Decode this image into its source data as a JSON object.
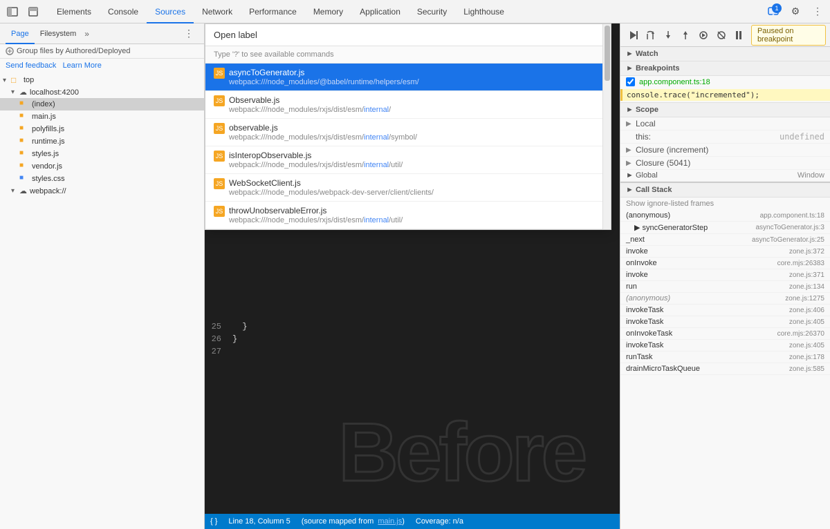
{
  "devtools": {
    "tabs": [
      {
        "label": "Elements",
        "active": false
      },
      {
        "label": "Console",
        "active": false
      },
      {
        "label": "Sources",
        "active": true
      },
      {
        "label": "Network",
        "active": false
      },
      {
        "label": "Performance",
        "active": false
      },
      {
        "label": "Memory",
        "active": false
      },
      {
        "label": "Application",
        "active": false
      },
      {
        "label": "Security",
        "active": false
      },
      {
        "label": "Lighthouse",
        "active": false
      }
    ],
    "badge_count": "1"
  },
  "left_panel": {
    "tabs": [
      "Page",
      "Filesystem"
    ],
    "active_tab": "Page",
    "group_label": "Group files by Authored/Deployed",
    "send_feedback": "Send feedback",
    "learn_more": "Learn More",
    "file_tree": {
      "root": "top",
      "items": [
        {
          "indent": 0,
          "type": "folder-expand",
          "name": "top",
          "selected": false
        },
        {
          "indent": 1,
          "type": "cloud-expand",
          "name": "localhost:4200",
          "selected": false
        },
        {
          "indent": 2,
          "type": "file-special",
          "name": "(index)",
          "selected": true
        },
        {
          "indent": 2,
          "type": "file-js",
          "name": "main.js",
          "selected": false
        },
        {
          "indent": 2,
          "type": "file-js",
          "name": "polyfills.js",
          "selected": false
        },
        {
          "indent": 2,
          "type": "file-js",
          "name": "runtime.js",
          "selected": false
        },
        {
          "indent": 2,
          "type": "file-js",
          "name": "styles.js",
          "selected": false
        },
        {
          "indent": 2,
          "type": "file-js",
          "name": "vendor.js",
          "selected": false
        },
        {
          "indent": 2,
          "type": "file-css",
          "name": "styles.css",
          "selected": false
        },
        {
          "indent": 1,
          "type": "cloud-expand",
          "name": "webpack://",
          "selected": false
        }
      ]
    }
  },
  "open_file_dialog": {
    "label": "Open",
    "input_value": "label",
    "hint": "Type '?' to see available commands",
    "results": [
      {
        "name": "asyncToGenerator.js",
        "path": "webpack:///node_modules/@babel/runtime/helpers/esm/",
        "path_highlight_start": 45,
        "active": true
      },
      {
        "name": "Observable.js",
        "path": "webpack:///node_modules/rxjs/dist/esm/internal/",
        "path_highlight": "internal",
        "active": false
      },
      {
        "name": "observable.js",
        "path": "webpack:///node_modules/rxjs/dist/esm/internal/symbol/",
        "path_highlight": "internal",
        "active": false
      },
      {
        "name": "isInteropObservable.js",
        "path": "webpack:///node_modules/rxjs/dist/esm/internal/util/",
        "path_highlight": "internal",
        "active": false
      },
      {
        "name": "WebSocketClient.js",
        "path": "webpack:///node_modules/webpack-dev-server/client/clients/",
        "path_highlight": null,
        "active": false
      },
      {
        "name": "throwUnobservableError.js",
        "path": "webpack:///node_modules/rxjs/dist/esm/internal/util/",
        "path_highlight": "internal",
        "active": false
      }
    ]
  },
  "editor": {
    "lines": [
      {
        "num": 25,
        "code": "  }"
      },
      {
        "num": 26,
        "code": "}"
      },
      {
        "num": 27,
        "code": ""
      }
    ],
    "watermark": "Before",
    "bottom_bar": {
      "location": "Line 18, Column 5",
      "source_map": "(source mapped from",
      "source_file": "main.js",
      "coverage": "Coverage: n/a"
    }
  },
  "right_panel": {
    "toolbar_icons": [
      "resume",
      "step-over",
      "step-into",
      "step-out",
      "step",
      "deactivate",
      "pause"
    ],
    "paused_label": "Paused on breakpoint",
    "sections": {
      "watch": "atch",
      "breakpoints": {
        "title": "eakpoints",
        "file": "app.component.ts:18",
        "code": "console.trace(\"incremented\");"
      },
      "scope": {
        "title": "cope",
        "items": [
          {
            "arrow": false,
            "name": "ocal",
            "val": ""
          },
          {
            "arrow": false,
            "name": "his:",
            "val": "undefined"
          },
          {
            "arrow": true,
            "name": "osure (increment)",
            "val": ""
          },
          {
            "arrow": true,
            "name": "osure (5041)",
            "val": ""
          },
          {
            "name": "lobal",
            "val": "Window",
            "arrow": false
          }
        ]
      },
      "call_stack": {
        "title": "all Stack",
        "show_ignore": "how ignore-listed frames",
        "items": [
          {
            "fn": "(anonymous)",
            "file": "app.component.ts:18",
            "italic": false
          },
          {
            "fn": "▶ syncGeneratorStep",
            "file": "",
            "italic": false,
            "indent": true
          },
          {
            "fn": "_next",
            "file": "asyncToGenerator.js:25",
            "italic": false
          },
          {
            "fn": "invoke",
            "file": "zone.js:372",
            "italic": false
          },
          {
            "fn": "onInvoke",
            "file": "core.mjs:26383",
            "italic": false
          },
          {
            "fn": "invoke",
            "file": "zone.js:371",
            "italic": false
          },
          {
            "fn": "run",
            "file": "zone.js:134",
            "italic": false
          },
          {
            "fn": "(anonymous)",
            "file": "zone.js:1275",
            "italic": true
          },
          {
            "fn": "invokeTask",
            "file": "zone.js:406",
            "italic": false
          },
          {
            "fn": "invokeTask",
            "file": "zone.js:405",
            "italic": false
          },
          {
            "fn": "onInvokeTask",
            "file": "core.mjs:26370",
            "italic": false
          },
          {
            "fn": "invokeTask",
            "file": "zone.js:405",
            "italic": false
          },
          {
            "fn": "runTask",
            "file": "zone.js:178",
            "italic": false
          },
          {
            "fn": "drainMicroTaskQueue",
            "file": "zone.js:585",
            "italic": false
          }
        ]
      }
    }
  }
}
